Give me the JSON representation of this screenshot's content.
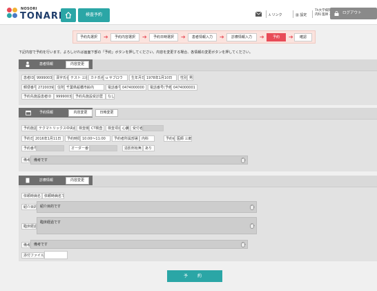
{
  "header": {
    "logo_small": "NOSORI",
    "logo_big": "TONARI",
    "page_tab": "検査予約",
    "link_label": "リンク",
    "settings_label": "設定",
    "user_line1": "Th大学病院",
    "user_line2": "内科 医師 三郎",
    "logout_label": "ログアウト",
    "brand_colors": {
      "teal": "#2ba6a6",
      "red": "#e84b57",
      "navy": "#1f3d6b"
    }
  },
  "steps": [
    "予約先選択",
    "予約内容選択",
    "予約日時選択",
    "患者情報入力",
    "診療情報入力",
    "予約",
    "確認"
  ],
  "active_step_index": 5,
  "notice": "下記内容で予約を行います。よろしければ画面下部の「予約」ボタンを押してください。内容を変更する場合、各情報の変更ボタンを押してください。",
  "patient": {
    "title": "患者情報",
    "change_label": "内容変更",
    "rows": [
      [
        [
          "患者ID",
          "9999003"
        ],
        [
          "漢字氏名",
          "テスト 三郎"
        ],
        [
          "カナ氏名",
          "u サブロウ"
        ],
        [
          "生年月日",
          "1978年1月10日"
        ],
        [
          "性別",
          "男"
        ]
      ],
      [
        [
          "郵便番号",
          "2720039"
        ],
        [
          "住所",
          "千葉県船橋市鈴内"
        ],
        [
          "電話番号",
          "0474000000"
        ],
        [
          "電話番号(予備)",
          "0474000001"
        ]
      ],
      [
        [
          "予約先施設患者ID",
          "9999003"
        ],
        [
          "予約先施設受診歴",
          "なし"
        ]
      ]
    ]
  },
  "reservation": {
    "title": "予約情報",
    "change_label": "内容変更",
    "datetime_change_label": "日時変更",
    "facility_label": "予約施設",
    "facility": "テクマトリックス中央病院",
    "equipment_label": "検査機",
    "equipment": "CT検査",
    "exam_item_label": "検査項目",
    "exam_item": "心臓",
    "receptionist_label": "受付者",
    "receptionist": "",
    "date_label": "予約日",
    "date": "2016年1月11日",
    "time_label": "予約時間",
    "time": "10:00～11:00",
    "department_label": "予約者所属部署",
    "department": "内科",
    "booker_label": "予約者",
    "booker": "医師 三郎",
    "number_label": "予約番号",
    "number": "",
    "order_label": "オーダー番号",
    "order": "",
    "contrast_label": "造影剤有無",
    "contrast": "あり",
    "remarks_label": "備考",
    "remarks": "備考です"
  },
  "clinical": {
    "title": "診療情報",
    "change_label": "内容変更",
    "disease_label": "依頼時病名",
    "disease": "依頼時病名です",
    "purpose_label": "紹介目的",
    "purpose": "紹介目的です",
    "progress_label": "臨床経過",
    "progress": "臨床経過です",
    "remarks_label": "備考",
    "remarks": "備考です",
    "attachment_label": "添付ファイル",
    "attachment": ""
  },
  "reserve_button": "予 約"
}
